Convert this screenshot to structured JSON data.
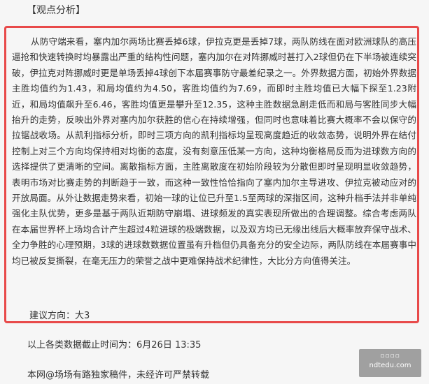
{
  "section": {
    "heading": "【观点分析】"
  },
  "analysis": {
    "body": "从防守端来看，塞内加尔两场比赛丢掉6球，伊拉克更是丢掉7球，两队防线在面对欧洲球队的高压逼抢和快速转换时均暴露出严重的结构性问题，塞内加尔在对阵挪威时甚打入2球但仍在下半场被连续突破，伊拉克对阵挪威时更是单场丢掉4球创下本届赛事防守最差纪录之一。外界数据方面，初始外界数据主胜均值约为1.43，和局均值约为4.50，客胜均值约为7.69，而即时主胜均值已大幅下探至1.23附近，和局均值飙升至6.46，客胜均值更是攀升至12.35，这种主胜数据急剧走低而和局与客胜同步大幅抬升的走势，反映出外界对塞内加尔获胜的信心在持续增强，但同时也意味着比赛大概率不会以保守的拉锯战收场。从凯利指标分析，即时三项方向的凯利指标均呈现高度趋近的收敛态势，说明外界在结付控制上对三个方向均保持相对均衡的态度，没有刻意压低某一方向，这种均衡格局反而为进球数方向的选择提供了更清晰的空间。离散指标方面，主胜离散度在初始阶段较为分散但即时呈现明显收敛趋势，表明市场对比赛走势的判断趋于一致，而这种一致性恰恰指向了塞内加尔主导进攻、伊拉克被动应对的开放局面。从外让数据走势来看，初始一球的让位已升至1.5至两球的深指区间，这种升档手法并非单纯强化主队优势，更多是基于两队近期防守崩塌、进球频发的真实表现所做出的合理调整。综合考虑两队在本届世界杯上场均合计产生超过4粒进球的极端数据，以及双方均已无缘出线后大概率放弃保守战术、全力争胜的心理预期，3球的进球数数据位置虽有升档但仍具备充分的安全边际，两队防线在本届赛事中均已被反复撕裂，在毫无压力的荣誉之战中更难保持战术纪律性，大比分方向值得关注。",
    "suggestion": "建议方向：大3"
  },
  "footer": {
    "deadline": "以上各类数据截止时间为：6月26日 13:35",
    "copyright": "本网@场场有路独家稿件，未经许可严禁转载"
  },
  "watermark": {
    "site": "ndtedu.com"
  },
  "colors": {
    "border": "#e84a4a",
    "text": "#333333",
    "background": "#f6f6f6"
  }
}
